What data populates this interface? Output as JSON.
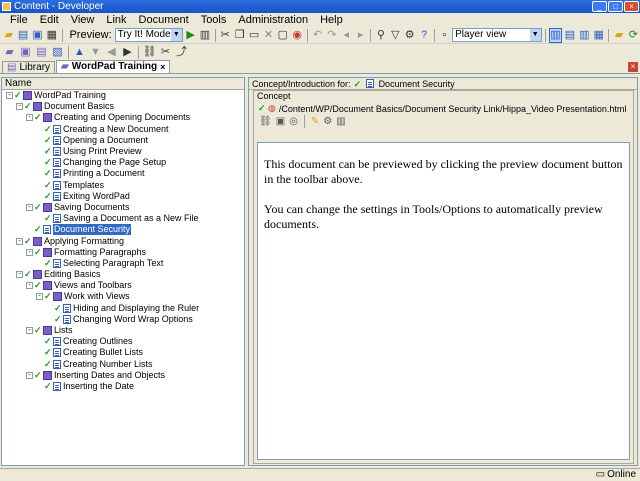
{
  "window": {
    "title": "Content - Developer"
  },
  "menu": [
    "File",
    "Edit",
    "View",
    "Link",
    "Document",
    "Tools",
    "Administration",
    "Help"
  ],
  "toolbar": {
    "preview_label": "Preview:",
    "preview_mode": "Try It! Mode",
    "player_view": "Player view"
  },
  "tabs": [
    {
      "label": "Library"
    },
    {
      "label": "WordPad Training"
    }
  ],
  "tree": {
    "header": "Name",
    "rows": [
      {
        "depth": 0,
        "label": "WordPad Training",
        "type": "book",
        "expand": "-"
      },
      {
        "depth": 1,
        "label": "Document Basics",
        "type": "book",
        "expand": "-"
      },
      {
        "depth": 2,
        "label": "Creating and Opening Documents",
        "type": "book",
        "expand": "-"
      },
      {
        "depth": 3,
        "label": "Creating a New Document",
        "type": "page"
      },
      {
        "depth": 3,
        "label": "Opening a Document",
        "type": "page"
      },
      {
        "depth": 3,
        "label": "Using Print Preview",
        "type": "page"
      },
      {
        "depth": 3,
        "label": "Changing the Page Setup",
        "type": "page"
      },
      {
        "depth": 3,
        "label": "Printing a Document",
        "type": "page"
      },
      {
        "depth": 3,
        "label": "Templates",
        "type": "page"
      },
      {
        "depth": 3,
        "label": "Exiting WordPad",
        "type": "page"
      },
      {
        "depth": 2,
        "label": "Saving Documents",
        "type": "book",
        "expand": "-"
      },
      {
        "depth": 3,
        "label": "Saving a Document as a New File",
        "type": "page"
      },
      {
        "depth": 2,
        "label": "Document Security",
        "type": "doc",
        "selected": true
      },
      {
        "depth": 1,
        "label": "Applying Formatting",
        "type": "book",
        "expand": "-"
      },
      {
        "depth": 2,
        "label": "Formatting Paragraphs",
        "type": "book",
        "expand": "-"
      },
      {
        "depth": 3,
        "label": "Selecting Paragraph Text",
        "type": "page"
      },
      {
        "depth": 1,
        "label": "Editing Basics",
        "type": "book",
        "expand": "-"
      },
      {
        "depth": 2,
        "label": "Views and Toolbars",
        "type": "book",
        "expand": "-"
      },
      {
        "depth": 3,
        "label": "Work with Views",
        "type": "book",
        "expand": "-"
      },
      {
        "depth": 4,
        "label": "Hiding and Displaying the Ruler",
        "type": "page"
      },
      {
        "depth": 4,
        "label": "Changing Word Wrap Options",
        "type": "page"
      },
      {
        "depth": 2,
        "label": "Lists",
        "type": "book",
        "expand": "-"
      },
      {
        "depth": 3,
        "label": "Creating Outlines",
        "type": "page"
      },
      {
        "depth": 3,
        "label": "Creating Bullet Lists",
        "type": "page"
      },
      {
        "depth": 3,
        "label": "Creating Number Lists",
        "type": "page"
      },
      {
        "depth": 2,
        "label": "Inserting Dates and Objects",
        "type": "book",
        "expand": "-"
      },
      {
        "depth": 3,
        "label": "Inserting the Date",
        "type": "page"
      }
    ]
  },
  "concept": {
    "header_prefix": "Concept/Introduction for:",
    "header_title": "Document Security",
    "legend": "Concept",
    "path": "/Content/WP/Document Basics/Document Security Link/Hippa_Video Presentation.html",
    "paragraphs": [
      "This document can be previewed by clicking the preview document button in the toolbar above.",
      "You can change the settings in Tools/Options to automatically preview documents."
    ]
  },
  "status": {
    "online": "Online"
  }
}
